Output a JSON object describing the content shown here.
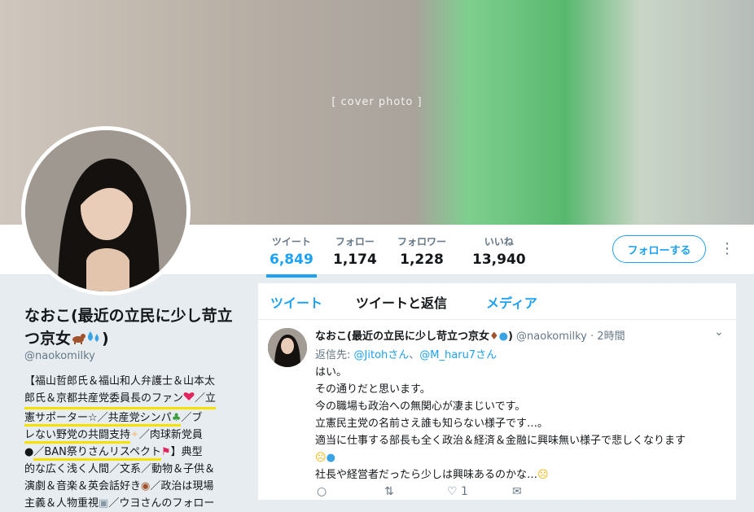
{
  "banner": {
    "photo_label": "[ cover photo ]"
  },
  "stats": [
    {
      "label": "ツイート",
      "value": "6,849"
    },
    {
      "label": "フォロー",
      "value": "1,174"
    },
    {
      "label": "フォロワー",
      "value": "1,228"
    },
    {
      "label": "いいね",
      "value": "13,940"
    }
  ],
  "follow_button": "フォローする",
  "profile": {
    "name": "なおこ(最近の立民に少し苛立つ京女",
    "handle": "@naokomilky",
    "bio_lines": [
      "【福山哲郎氏＆福山和人弁護士＆山本太",
      "郎氏＆京都共産党委員長のファン",
      "憲サポーター",
      "／共産党シンパ",
      "／ブ",
      "レない野党の共闘支持",
      "／肉球新党員",
      "／BAN祭りさんリスペクト",
      "】典型",
      "的な広く浅く人間／文系／動物＆子供＆",
      "演劇＆音楽＆英会話好き",
      "／政治は現場",
      "主義＆人物重視",
      "／ウヨさんのフォロー"
    ]
  },
  "tabs": [
    "ツイート",
    "ツイートと返信",
    "メディア"
  ],
  "tweet": {
    "name": "なおこ(最近の立民に少し苛立つ京女",
    "handle": "@naokomilky",
    "time": "2時間",
    "reply_prefix": "返信先:",
    "reply_user1": "@Jitohさん",
    "reply_sep": "、",
    "reply_user2": "@M_haru7さん",
    "lines": [
      "はい。",
      "その通りだと思います。",
      "今の職場も政治への無関心が凄まじいです。",
      "立憲民主党の名前さえ誰も知らない様子です…。",
      "適当に仕事する部長も全く政治＆経済＆金融に興味無い様子で悲しくなります",
      "社長や経営者だったら少しは興味あるのかな…"
    ],
    "like_count": "1"
  },
  "colors": {
    "accent": "#1da1f2",
    "highlight": "#f5e000"
  }
}
